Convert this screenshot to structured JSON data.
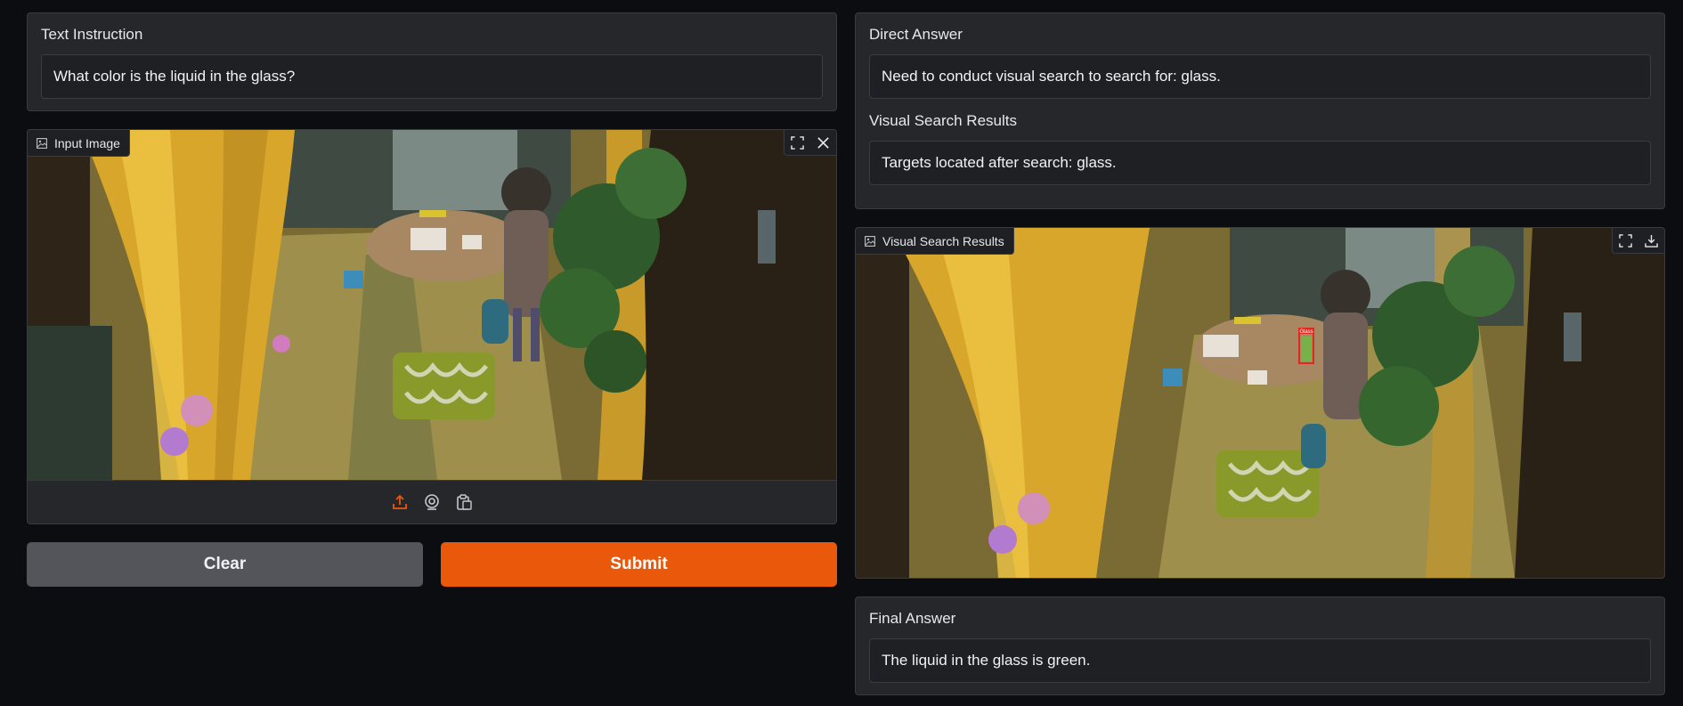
{
  "left": {
    "instruction_label": "Text Instruction",
    "instruction_value": "What color is the liquid in the glass?",
    "input_image_label": "Input Image",
    "clear_label": "Clear",
    "submit_label": "Submit"
  },
  "right": {
    "direct_answer_label": "Direct Answer",
    "direct_answer_value": "Need to conduct visual search to search for: glass.",
    "search_results_label": "Visual Search Results",
    "search_results_value": "Targets located after search: glass.",
    "result_image_label": "Visual Search Results",
    "detection_label": "Glass",
    "final_answer_label": "Final Answer",
    "final_answer_value": "The liquid in the glass is green."
  },
  "icons": {
    "image": "image-icon",
    "fullscreen": "fullscreen-icon",
    "close": "close-icon",
    "download": "download-icon",
    "upload": "upload-icon",
    "webcam": "webcam-icon",
    "clipboard": "clipboard-icon"
  },
  "colors": {
    "accent": "#ea580c",
    "background": "#0c0d10",
    "panel": "#26272b",
    "detection_box": "#e0281e"
  }
}
